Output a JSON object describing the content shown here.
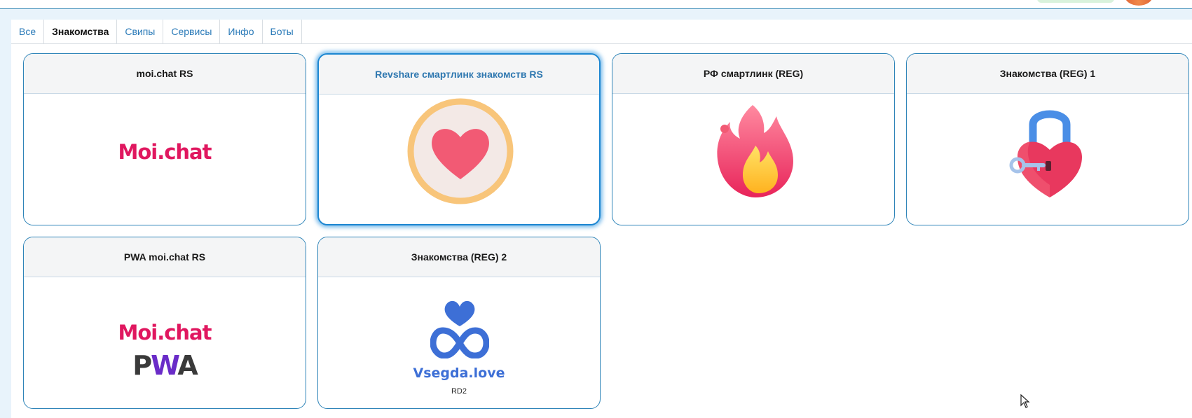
{
  "tabs": [
    {
      "label": "Все",
      "active": false
    },
    {
      "label": "Знакомства",
      "active": true
    },
    {
      "label": "Свипы",
      "active": false
    },
    {
      "label": "Сервисы",
      "active": false
    },
    {
      "label": "Инфо",
      "active": false
    },
    {
      "label": "Боты",
      "active": false
    }
  ],
  "cards": [
    {
      "title": "moi.chat RS",
      "logo_text": "Moi.chat",
      "icon": "moichat-logo"
    },
    {
      "title": "Revshare смартлинк знакомств RS",
      "icon": "heart-circle-icon",
      "selected": true
    },
    {
      "title": "РФ смартлинк (REG)",
      "icon": "fire-icon"
    },
    {
      "title": "Знакомства (REG) 1",
      "icon": "heart-lock-icon"
    },
    {
      "title": "PWA moi.chat RS",
      "logo_text": "Moi.chat",
      "logo_sub": "PWA",
      "icon": "moichat-pwa-logo"
    },
    {
      "title": "Знакомства (REG) 2",
      "logo_text": "Vsegda.love",
      "caption": "RD2",
      "icon": "vsegda-love-logo"
    }
  ],
  "colors": {
    "accent": "#2e84b8",
    "moi_brand": "#e0175f",
    "vsegda_brand": "#3d6fd6",
    "heart": "#f25a74",
    "ring": "#f8c57a"
  }
}
